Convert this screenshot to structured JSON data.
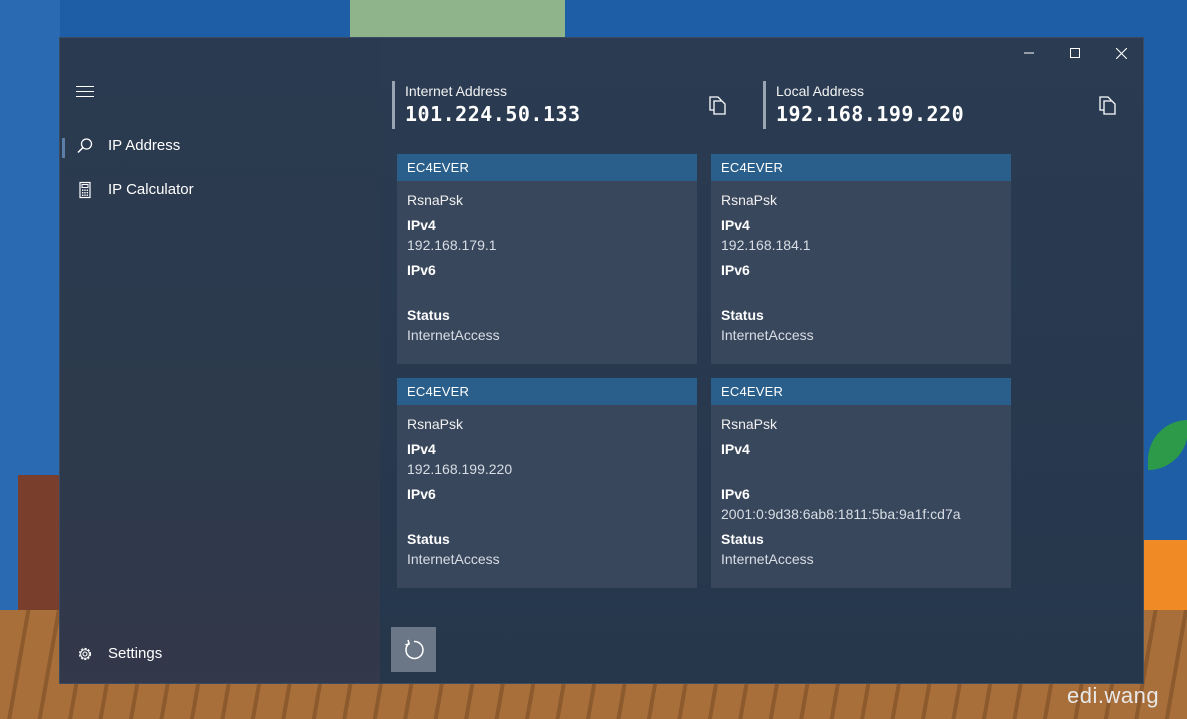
{
  "window": {
    "caption": {
      "minimize_icon": "minimize-icon",
      "maximize_icon": "maximize-icon",
      "close_icon": "close-icon"
    }
  },
  "nav": {
    "menu_icon": "hamburger-icon",
    "items": [
      {
        "label": "IP Address",
        "icon": "search-icon",
        "selected": true
      },
      {
        "label": "IP Calculator",
        "icon": "calculator-icon",
        "selected": false
      }
    ],
    "settings": {
      "label": "Settings",
      "icon": "gear-icon"
    }
  },
  "addresses": {
    "internet": {
      "label": "Internet Address",
      "value": "101.224.50.133",
      "copy_icon": "copy-icon"
    },
    "local": {
      "label": "Local Address",
      "value": "192.168.199.220",
      "copy_icon": "copy-icon"
    }
  },
  "labels": {
    "ipv4": "IPv4",
    "ipv6": "IPv6",
    "status": "Status"
  },
  "adapters": [
    {
      "header": "EC4EVER",
      "name": "RsnaPsk",
      "ipv4": "192.168.179.1",
      "ipv6": "",
      "status": "InternetAccess"
    },
    {
      "header": "EC4EVER",
      "name": "RsnaPsk",
      "ipv4": "192.168.184.1",
      "ipv6": "",
      "status": "InternetAccess"
    },
    {
      "header": "EC4EVER",
      "name": "RsnaPsk",
      "ipv4": "192.168.199.220",
      "ipv6": "",
      "status": "InternetAccess"
    },
    {
      "header": "EC4EVER",
      "name": "RsnaPsk",
      "ipv4": "",
      "ipv6": "2001:0:9d38:6ab8:1811:5ba:9a1f:cd7a",
      "status": "InternetAccess"
    }
  ],
  "refresh": {
    "icon": "refresh-icon"
  },
  "watermark": "edi.wang",
  "colors": {
    "card_header": "#2a5f8c",
    "window_bg": "#243449",
    "refresh_button": "#6b7786"
  }
}
